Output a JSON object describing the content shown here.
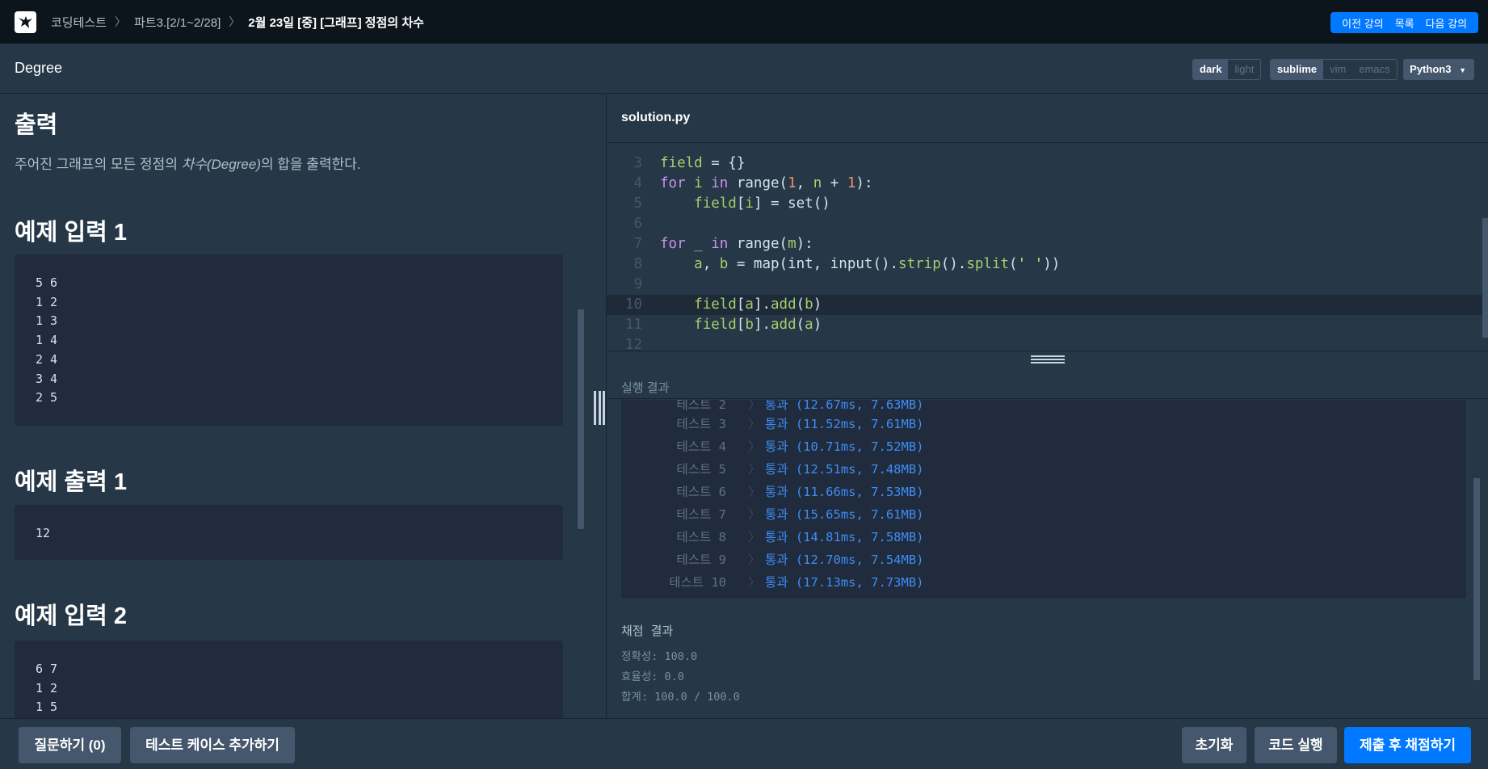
{
  "nav": {
    "breadcrumbs": [
      "코딩테스트",
      "파트3.[2/1~2/28]",
      "2월 23일 [중] [그래프] 정점의 차수"
    ],
    "prev_label": "이전 강의",
    "list_label": "목록",
    "next_label": "다음 강의"
  },
  "header": {
    "title": "Degree",
    "theme_options": [
      "dark",
      "light"
    ],
    "theme_selected": "dark",
    "keymap_options": [
      "sublime",
      "vim",
      "emacs"
    ],
    "keymap_selected": "sublime",
    "language": "Python3"
  },
  "problem": {
    "output_heading": "출력",
    "output_desc_pre": "주어진 그래프의 모든 정점의 ",
    "output_desc_em": "차수(Degree)",
    "output_desc_post": "의 합을 출력한다.",
    "example_input1_heading": "예제 입력 1",
    "example_input1": "5 6\n1 2\n1 3\n1 4\n2 4\n3 4\n2 5",
    "example_output1_heading": "예제 출력 1",
    "example_output1": "12",
    "example_input2_heading": "예제 입력 2",
    "example_input2": "6 7\n1 2\n1 5"
  },
  "editor": {
    "filename": "solution.py",
    "line_numbers": [
      "3",
      "4",
      "5",
      "6",
      "7",
      "8",
      "9",
      "10",
      "11",
      "12"
    ]
  },
  "results": {
    "label": "실행 결과",
    "tests": [
      {
        "name": "테스트 2",
        "result": "통과 (12.67ms, 7.63MB)"
      },
      {
        "name": "테스트 3",
        "result": "통과 (11.52ms, 7.61MB)"
      },
      {
        "name": "테스트 4",
        "result": "통과 (10.71ms, 7.52MB)"
      },
      {
        "name": "테스트 5",
        "result": "통과 (12.51ms, 7.48MB)"
      },
      {
        "name": "테스트 6",
        "result": "통과 (11.66ms, 7.53MB)"
      },
      {
        "name": "테스트 7",
        "result": "통과 (15.65ms, 7.61MB)"
      },
      {
        "name": "테스트 8",
        "result": "통과 (14.81ms, 7.58MB)"
      },
      {
        "name": "테스트 9",
        "result": "통과 (12.70ms, 7.54MB)"
      },
      {
        "name": "테스트 10",
        "result": "통과 (17.13ms, 7.73MB)"
      }
    ],
    "grade_title": "채점 결과",
    "accuracy": "정확성: 100.0",
    "efficiency": "효율성: 0.0",
    "total": "합계: 100.0 / 100.0"
  },
  "footer": {
    "question_label": "질문하기 (0)",
    "add_testcase_label": "테스트 케이스 추가하기",
    "reset_label": "초기화",
    "run_label": "코드 실행",
    "submit_label": "제출 후 채점하기"
  }
}
